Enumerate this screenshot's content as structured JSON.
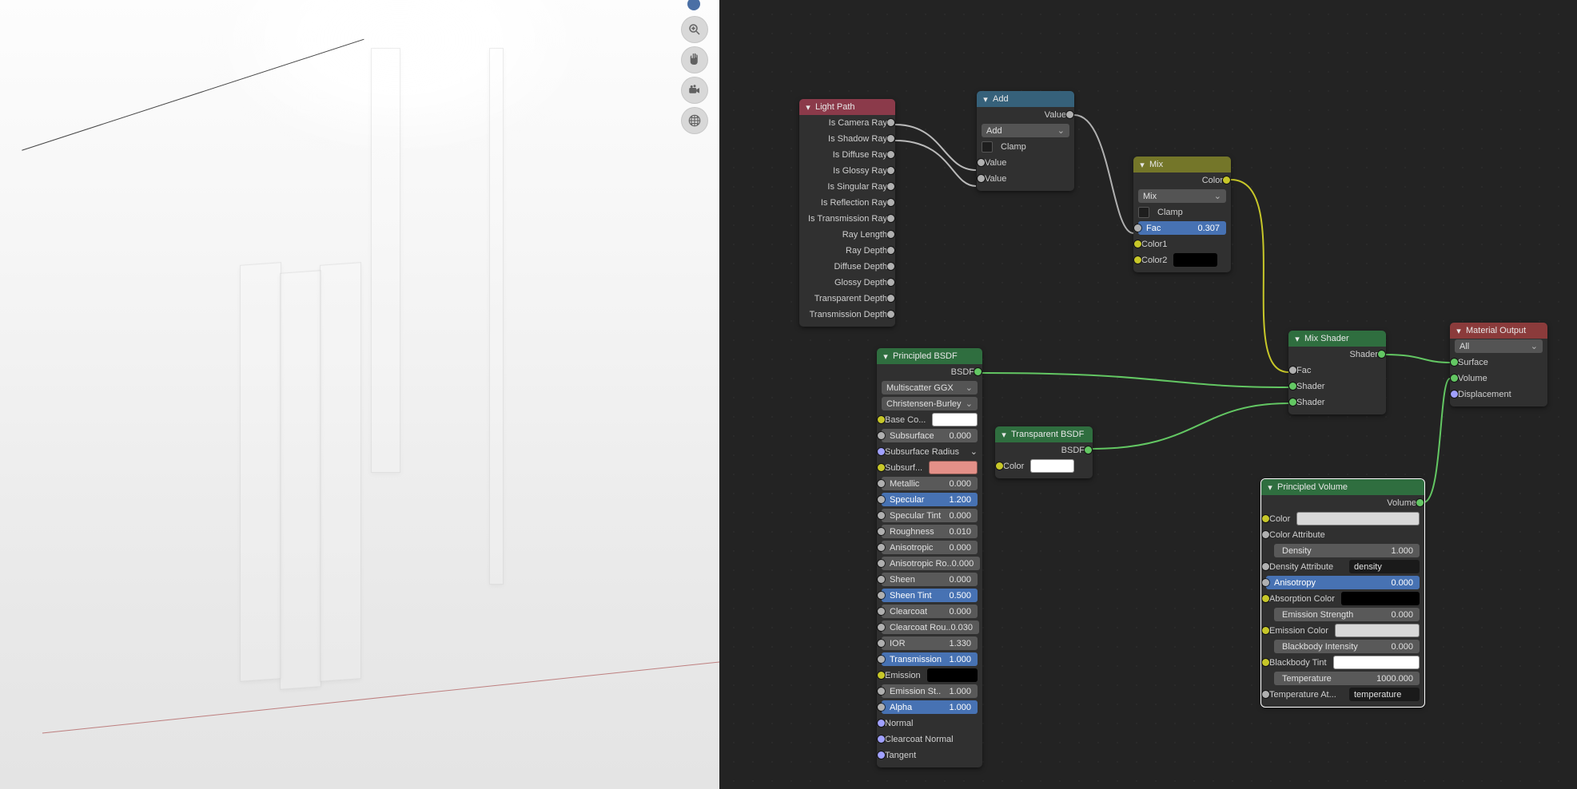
{
  "viewport": {
    "tool_zoom": "Zoom",
    "tool_pan": "Pan",
    "tool_camera": "Camera",
    "tool_grid": "Grid"
  },
  "nodes": {
    "lightpath": {
      "title": "Light Path",
      "outputs": [
        "Is Camera Ray",
        "Is Shadow Ray",
        "Is Diffuse Ray",
        "Is Glossy Ray",
        "Is Singular Ray",
        "Is Reflection Ray",
        "Is Transmission Ray",
        "Ray Length",
        "Ray Depth",
        "Diffuse Depth",
        "Glossy Depth",
        "Transparent Depth",
        "Transmission Depth"
      ]
    },
    "add": {
      "title": "Add",
      "out_value": "Value",
      "op": "Add",
      "clamp": "Clamp",
      "in_value1": "Value",
      "in_value2": "Value"
    },
    "mix": {
      "title": "Mix",
      "out_color": "Color",
      "blend": "Mix",
      "clamp": "Clamp",
      "fac_label": "Fac",
      "fac_value": "0.307",
      "color1": "Color1",
      "color2": "Color2",
      "color2_swatch": "#000000"
    },
    "principled": {
      "title": "Principled BSDF",
      "out": "BSDF",
      "dist": "Multiscatter GGX",
      "sss": "Christensen-Burley",
      "base_color_label": "Base Co...",
      "base_color_swatch": "#ffffff",
      "subsurface_label": "Subsurface",
      "subsurface_value": "0.000",
      "subsurf_radius_label": "Subsurface Radius",
      "subsurf_color_label": "Subsurf...",
      "subsurf_color_swatch": "#e49088",
      "metallic_label": "Metallic",
      "metallic_value": "0.000",
      "specular_label": "Specular",
      "specular_value": "1.200",
      "spectint_label": "Specular Tint",
      "spectint_value": "0.000",
      "roughness_label": "Roughness",
      "roughness_value": "0.010",
      "aniso_label": "Anisotropic",
      "aniso_value": "0.000",
      "anisorot_label": "Anisotropic Ro..",
      "anisorot_value": "0.000",
      "sheen_label": "Sheen",
      "sheen_value": "0.000",
      "sheentint_label": "Sheen Tint",
      "sheentint_value": "0.500",
      "clearcoat_label": "Clearcoat",
      "clearcoat_value": "0.000",
      "clearcoatR_label": "Clearcoat Rou..",
      "clearcoatR_value": "0.030",
      "ior_label": "IOR",
      "ior_value": "1.330",
      "transmission_label": "Transmission",
      "transmission_value": "1.000",
      "emission_label": "Emission",
      "emission_swatch": "#000000",
      "emission_str_label": "Emission St..",
      "emission_str_value": "1.000",
      "alpha_label": "Alpha",
      "alpha_value": "1.000",
      "normal_label": "Normal",
      "cnormal_label": "Clearcoat Normal",
      "tangent_label": "Tangent"
    },
    "transparent": {
      "title": "Transparent BSDF",
      "out": "BSDF",
      "color_label": "Color",
      "color_swatch": "#ffffff"
    },
    "mixshader": {
      "title": "Mix Shader",
      "out": "Shader",
      "fac_label": "Fac",
      "shader1": "Shader",
      "shader2": "Shader"
    },
    "volume": {
      "title": "Principled Volume",
      "out": "Volume",
      "color_label": "Color",
      "color_swatch": "#d8d8d8",
      "color_attr_label": "Color Attribute",
      "density_label": "Density",
      "density_value": "1.000",
      "density_attr_label": "Density Attribute",
      "density_attr_value": "density",
      "aniso_label": "Anisotropy",
      "aniso_value": "0.000",
      "absorb_label": "Absorption Color",
      "absorb_swatch": "#000000",
      "estr_label": "Emission Strength",
      "estr_value": "0.000",
      "ecolor_label": "Emission Color",
      "ecolor_swatch": "#d8d8d8",
      "bbint_label": "Blackbody Intensity",
      "bbint_value": "0.000",
      "bbtint_label": "Blackbody Tint",
      "bbtint_swatch": "#ffffff",
      "temp_label": "Temperature",
      "temp_value": "1000.000",
      "tempattr_label": "Temperature At...",
      "tempattr_value": "temperature"
    },
    "output": {
      "title": "Material Output",
      "target": "All",
      "surface": "Surface",
      "volume": "Volume",
      "displacement": "Displacement"
    }
  }
}
